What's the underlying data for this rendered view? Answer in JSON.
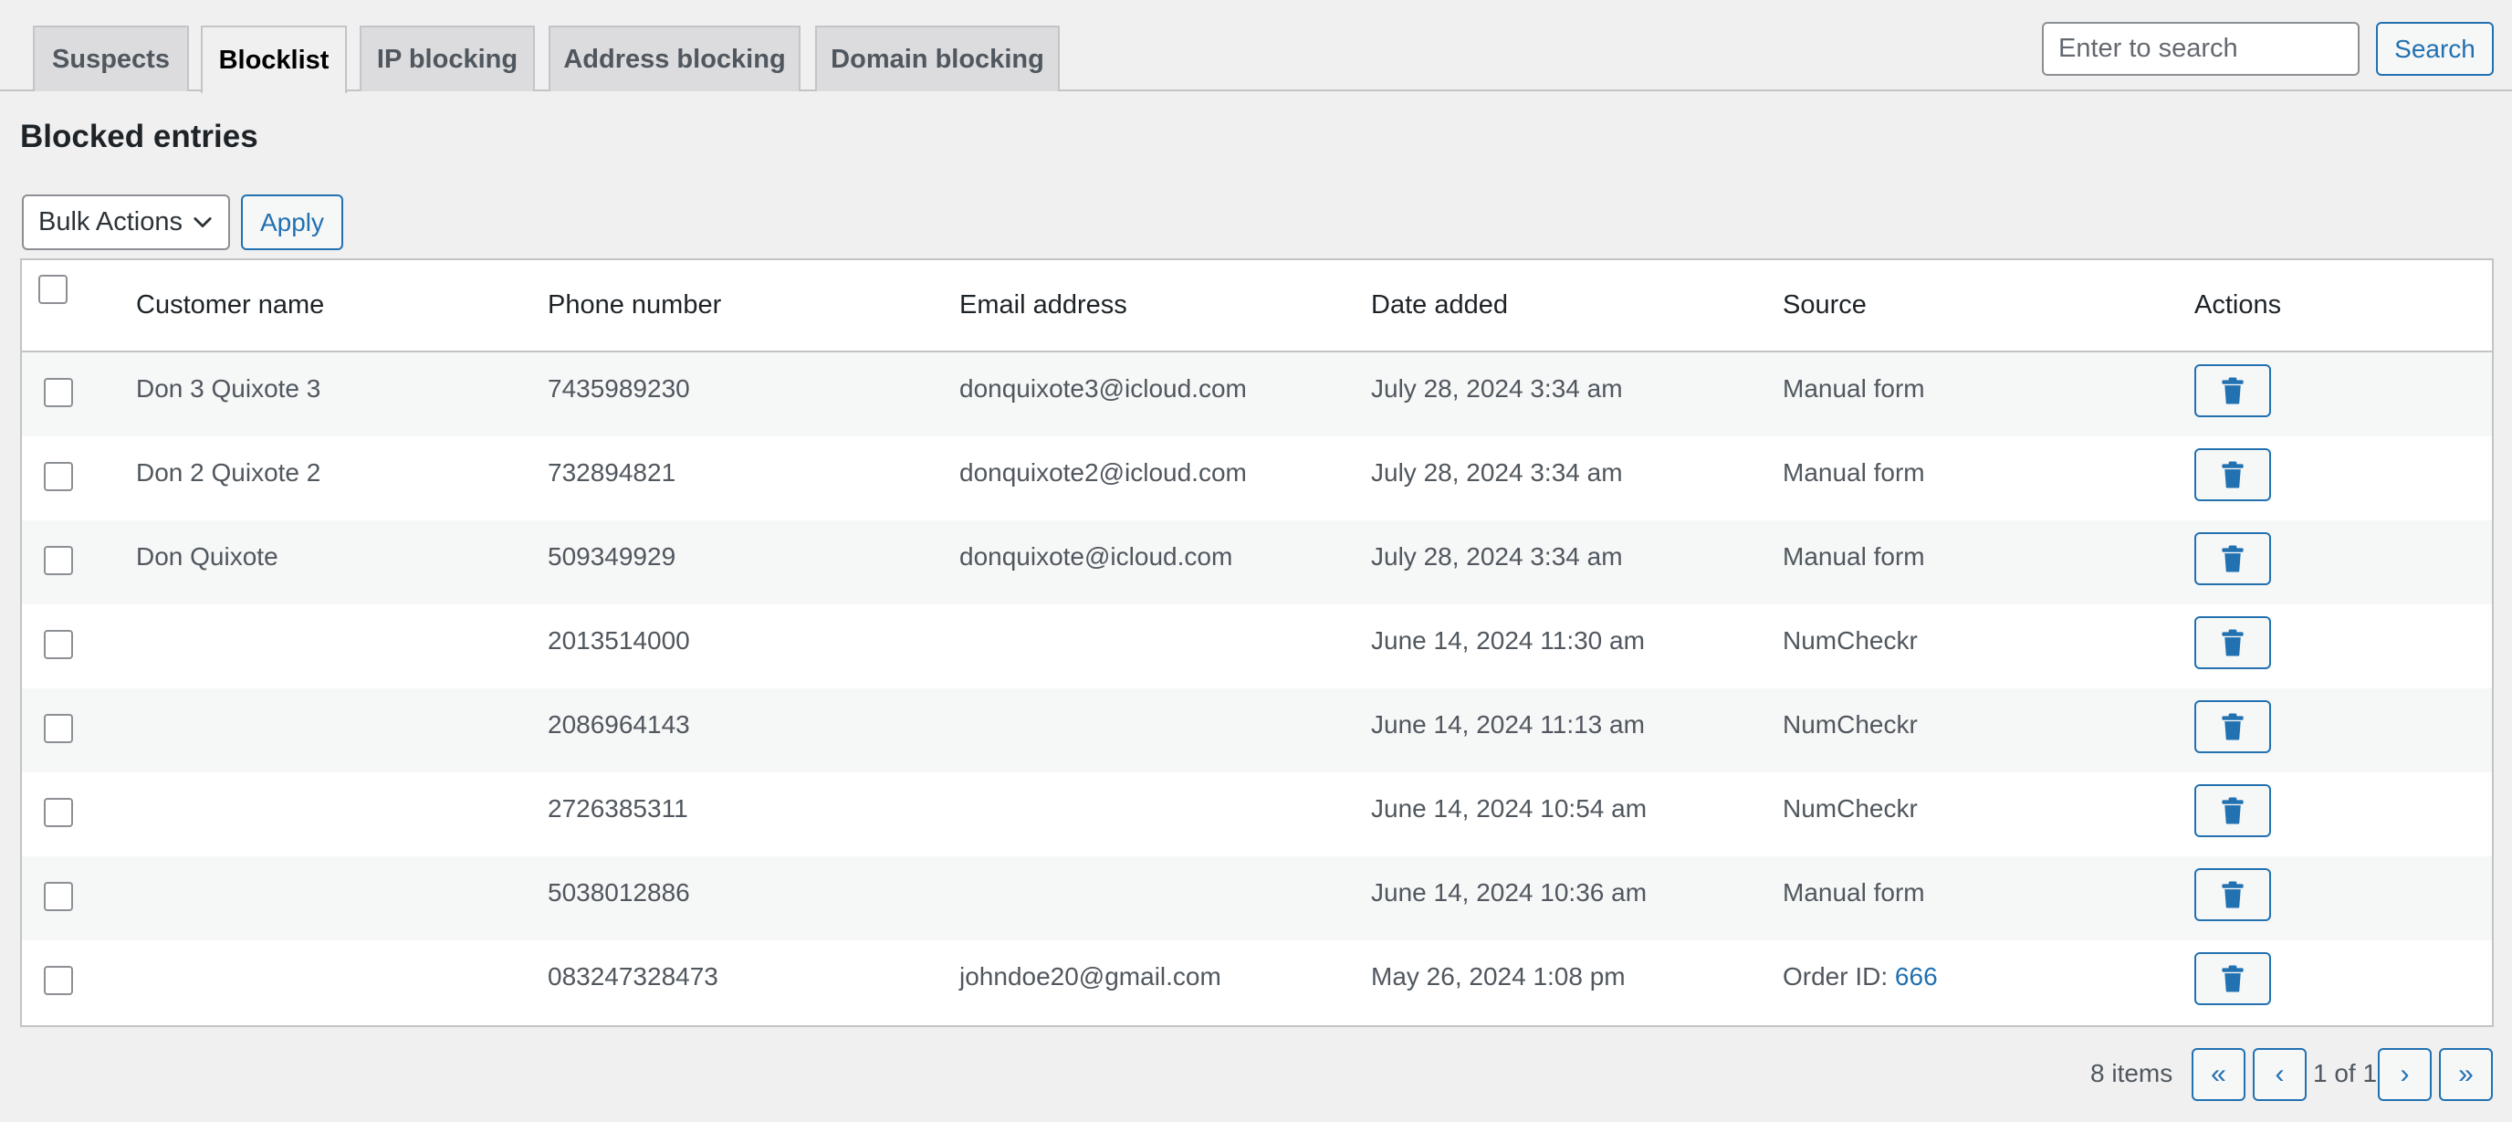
{
  "tabs": [
    {
      "label": "Suspects",
      "active": false
    },
    {
      "label": "Blocklist",
      "active": true
    },
    {
      "label": "IP blocking",
      "active": false
    },
    {
      "label": "Address blocking",
      "active": false
    },
    {
      "label": "Domain blocking",
      "active": false
    }
  ],
  "search": {
    "placeholder": "Enter to search",
    "value": "",
    "button_label": "Search"
  },
  "page_title": "Blocked entries",
  "bulk_actions": {
    "selected": "Bulk Actions",
    "apply_label": "Apply"
  },
  "table": {
    "headers": {
      "customer_name": "Customer name",
      "phone": "Phone number",
      "email": "Email address",
      "date": "Date added",
      "source": "Source",
      "actions": "Actions"
    },
    "rows": [
      {
        "customer_name": "Don 3 Quixote 3",
        "phone": "7435989230",
        "email": "donquixote3@icloud.com",
        "date": "July 28, 2024 3:34 am",
        "source": "Manual form",
        "source_link": ""
      },
      {
        "customer_name": "Don 2 Quixote 2",
        "phone": "732894821",
        "email": "donquixote2@icloud.com",
        "date": "July 28, 2024 3:34 am",
        "source": "Manual form",
        "source_link": ""
      },
      {
        "customer_name": "Don Quixote",
        "phone": "509349929",
        "email": "donquixote@icloud.com",
        "date": "July 28, 2024 3:34 am",
        "source": "Manual form",
        "source_link": ""
      },
      {
        "customer_name": "",
        "phone": "2013514000",
        "email": "",
        "date": "June 14, 2024 11:30 am",
        "source": "NumCheckr",
        "source_link": ""
      },
      {
        "customer_name": "",
        "phone": "2086964143",
        "email": "",
        "date": "June 14, 2024 11:13 am",
        "source": "NumCheckr",
        "source_link": ""
      },
      {
        "customer_name": "",
        "phone": "2726385311",
        "email": "",
        "date": "June 14, 2024 10:54 am",
        "source": "NumCheckr",
        "source_link": ""
      },
      {
        "customer_name": "",
        "phone": "5038012886",
        "email": "",
        "date": "June 14, 2024 10:36 am",
        "source": "Manual form",
        "source_link": ""
      },
      {
        "customer_name": "",
        "phone": "083247328473",
        "email": "johndoe20@gmail.com",
        "date": "May 26, 2024 1:08 pm",
        "source": "Order ID: ",
        "source_link": "666"
      }
    ]
  },
  "pagination": {
    "items_count": "8 items",
    "first": "«",
    "prev": "‹",
    "page_info": "1 of 1",
    "next": "›",
    "last": "»"
  },
  "colors": {
    "accent": "#2271b1",
    "background": "#f0f0f1",
    "text": "#1d2327",
    "muted": "#50575e"
  },
  "icons": {
    "row_action": "trash-icon",
    "bulk_select": "chevron-down-icon"
  }
}
